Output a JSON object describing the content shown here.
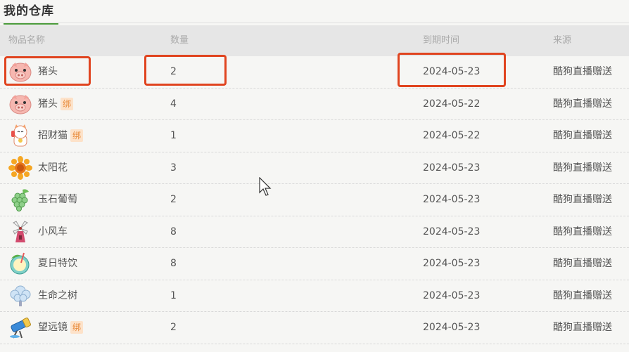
{
  "page": {
    "title": "我的仓库"
  },
  "table": {
    "columns": [
      "物品名称",
      "数量",
      "到期时间",
      "来源"
    ],
    "rows": [
      {
        "icon": "pig-head-icon",
        "name": "猪头",
        "bound": "",
        "qty": "2",
        "expiry": "2024-05-23",
        "source": "酷狗直播赠送"
      },
      {
        "icon": "pig-head-icon",
        "name": "猪头",
        "bound": "绑",
        "qty": "4",
        "expiry": "2024-05-22",
        "source": "酷狗直播赠送"
      },
      {
        "icon": "lucky-cat-icon",
        "name": "招财猫",
        "bound": "绑",
        "qty": "1",
        "expiry": "2024-05-22",
        "source": "酷狗直播赠送"
      },
      {
        "icon": "sunflower-icon",
        "name": "太阳花",
        "bound": "",
        "qty": "3",
        "expiry": "2024-05-23",
        "source": "酷狗直播赠送"
      },
      {
        "icon": "grapes-icon",
        "name": "玉石葡萄",
        "bound": "",
        "qty": "2",
        "expiry": "2024-05-23",
        "source": "酷狗直播赠送"
      },
      {
        "icon": "windmill-icon",
        "name": "小风车",
        "bound": "",
        "qty": "8",
        "expiry": "2024-05-23",
        "source": "酷狗直播赠送"
      },
      {
        "icon": "summer-drink-icon",
        "name": "夏日特饮",
        "bound": "",
        "qty": "8",
        "expiry": "2024-05-23",
        "source": "酷狗直播赠送"
      },
      {
        "icon": "tree-of-life-icon",
        "name": "生命之树",
        "bound": "",
        "qty": "1",
        "expiry": "2024-05-23",
        "source": "酷狗直播赠送"
      },
      {
        "icon": "telescope-icon",
        "name": "望远镜",
        "bound": "绑",
        "qty": "2",
        "expiry": "2024-05-23",
        "source": "酷狗直播赠送"
      }
    ]
  },
  "colors": {
    "accent": "#4a9a3a",
    "highlight": "#e0441f",
    "badge_bg": "#fde2c9",
    "badge_text": "#e88a3a"
  }
}
